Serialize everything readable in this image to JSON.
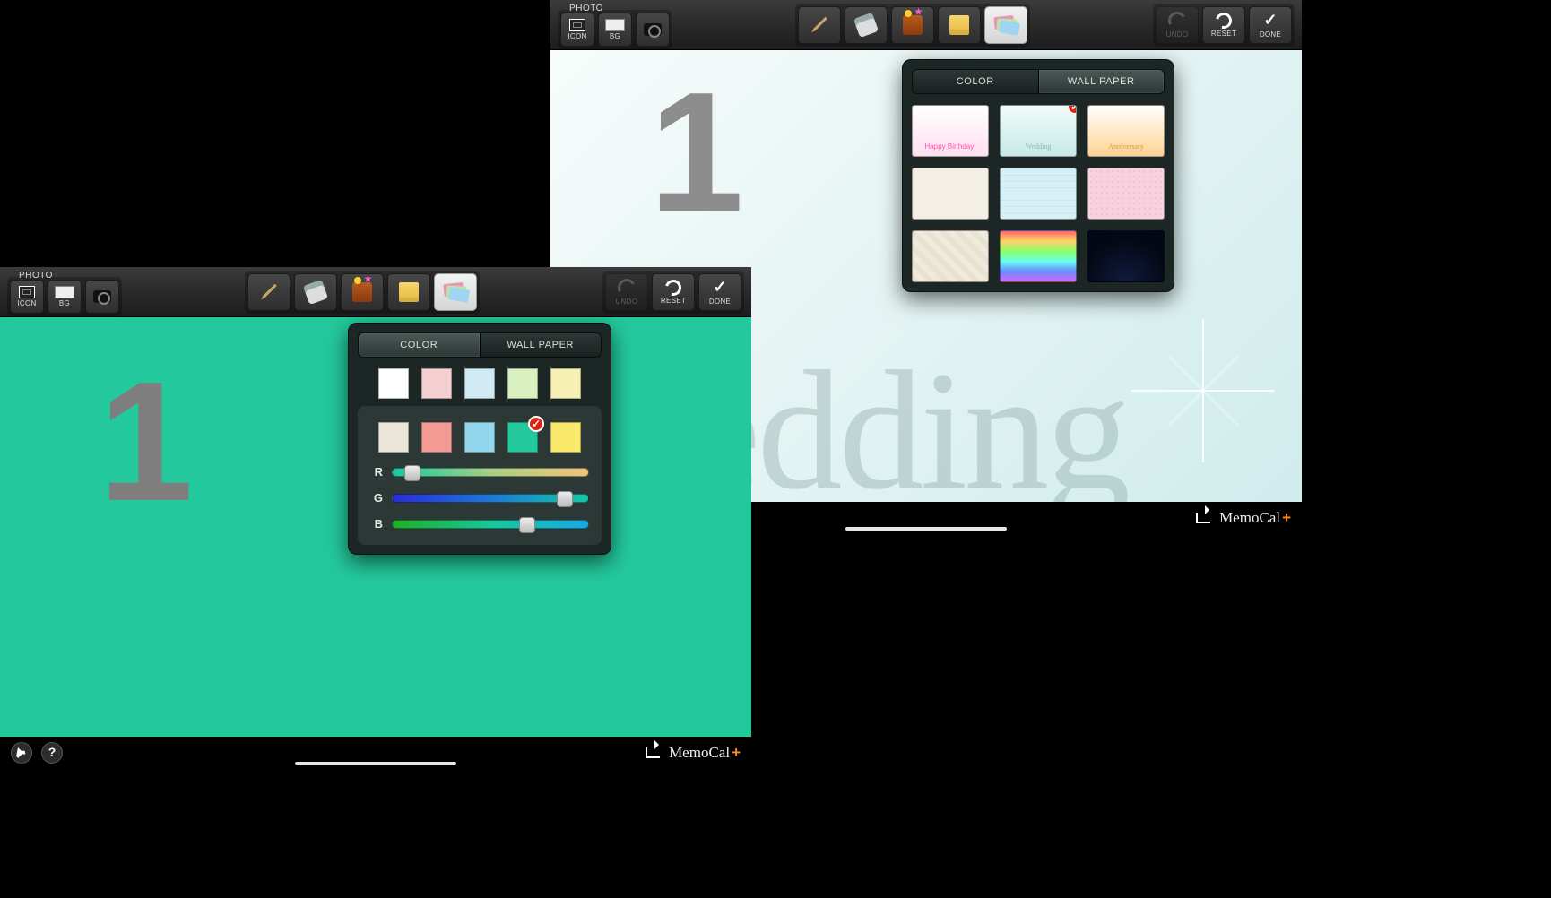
{
  "toolbar": {
    "photo_label": "PHOTO",
    "icon_label": "ICON",
    "bg_label": "BG",
    "undo": "UNDO",
    "reset": "RESET",
    "done": "DONE"
  },
  "canvas": {
    "date_number": "1"
  },
  "popover": {
    "tabs": {
      "color": "COLOR",
      "wallpaper": "WALL PAPER"
    },
    "sliders": {
      "r": "R",
      "g": "G",
      "b": "B"
    }
  },
  "left": {
    "active_tab": "color",
    "canvas_bg": "#23c99c",
    "swatch_row1": [
      "#ffffff",
      "#f3cfd0",
      "#cfeaf3",
      "#d9f0c1",
      "#f6f0b4"
    ],
    "swatch_row2": [
      "#ece6da",
      "#f39a94",
      "#92d6ec",
      "#23c99c",
      "#f8e96c"
    ],
    "selected_swatch": "#23c99c",
    "rgb": {
      "r": 35,
      "g": 201,
      "b": 156
    },
    "slider_pos": {
      "r": 0.1,
      "g": 0.88,
      "b": 0.69
    }
  },
  "right": {
    "active_tab": "wallpaper",
    "canvas_gradient": [
      "#f7fcfb",
      "#d0ecec"
    ],
    "wedding_text": "Wedding",
    "wallpapers": [
      {
        "id": "happy-birthday",
        "bg": "linear-gradient(#ffffff,#ffe0ef)",
        "caption": "Happy Birthday!",
        "caption_color": "#ff4fb3"
      },
      {
        "id": "wedding",
        "bg": "linear-gradient(#f0fbfa,#c7e9e8)",
        "caption": "Wedding",
        "caption_color": "#8fb8b4",
        "selected": true
      },
      {
        "id": "anniversary",
        "bg": "linear-gradient(#fff,#ffe1b5 70%,#ffd190)",
        "caption": "Anniversary",
        "caption_color": "#d99a3a"
      },
      {
        "id": "plain-cream",
        "bg": "#f4efe5"
      },
      {
        "id": "grid-blue",
        "bg": "repeating-linear-gradient(0deg,#d6f0f6 0 6px,#c6e8f0 6px 7px),repeating-linear-gradient(90deg,#d6f0f6 0 6px,#c6e8f0 6px 7px)"
      },
      {
        "id": "dots-pink",
        "bg": "radial-gradient(#f6b9cf 1px, #f7d1de 1px) 0 0/6px 6px"
      },
      {
        "id": "hatch-beige",
        "bg": "repeating-linear-gradient(45deg,#e8e2d2 0 6px,#efeadc 6px 12px)"
      },
      {
        "id": "rainbow",
        "bg": "linear-gradient(#ff6a6a,#ffd36a,#8cff6a,#6affef,#6a8cff,#c96aff)"
      },
      {
        "id": "night-sky",
        "bg": "radial-gradient(circle at 50% 100%, #101a3e, #040714 70%)"
      }
    ]
  },
  "footer": {
    "brand": "MemoCal",
    "brand_suffix": "+"
  }
}
